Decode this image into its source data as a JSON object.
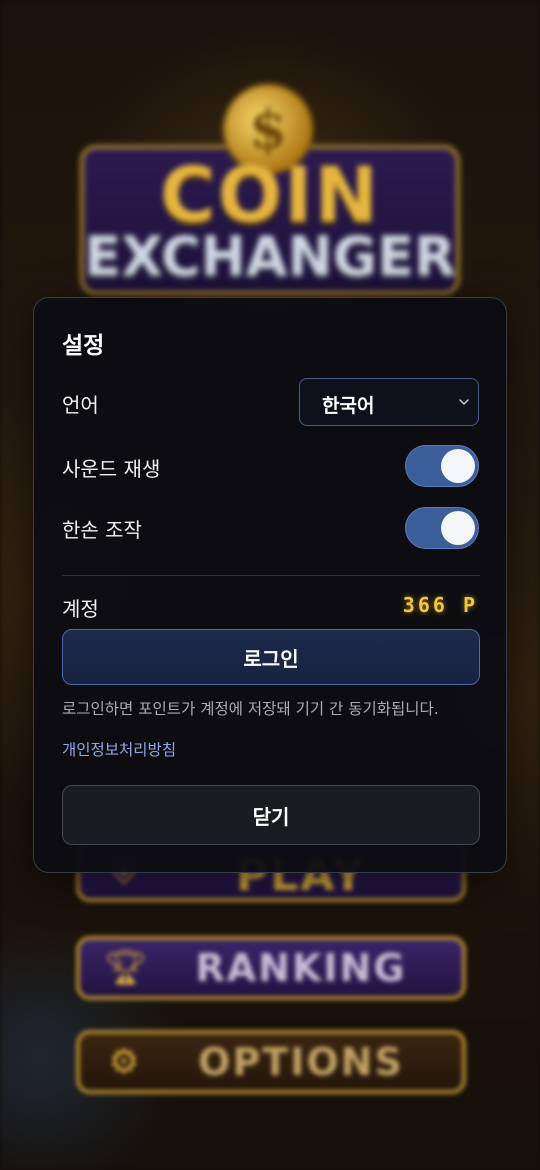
{
  "background": {
    "logo_line1": "COIN",
    "logo_line2": "EXCHANGER",
    "coin_symbol": "$",
    "menu": [
      {
        "label": "PLAY",
        "icon": "shield-icon"
      },
      {
        "label": "RANKING",
        "icon": "trophy-icon"
      },
      {
        "label": "OPTIONS",
        "icon": "gear-icon"
      }
    ]
  },
  "settings": {
    "title": "설정",
    "language": {
      "label": "언어",
      "selected": "한국어"
    },
    "sound": {
      "label": "사운드 재생",
      "enabled": true
    },
    "one_hand": {
      "label": "한손 조작",
      "enabled": true
    },
    "account": {
      "label": "계정",
      "points": "366 P",
      "login_label": "로그인",
      "hint": "로그인하면 포인트가 계정에 저장돼 기기 간 동기화됩니다.",
      "privacy_link": "개인정보처리방침"
    },
    "close_label": "닫기"
  },
  "colors": {
    "accent": "#3b5d99",
    "points": "#f4c63a",
    "link": "#8fa8e6"
  }
}
